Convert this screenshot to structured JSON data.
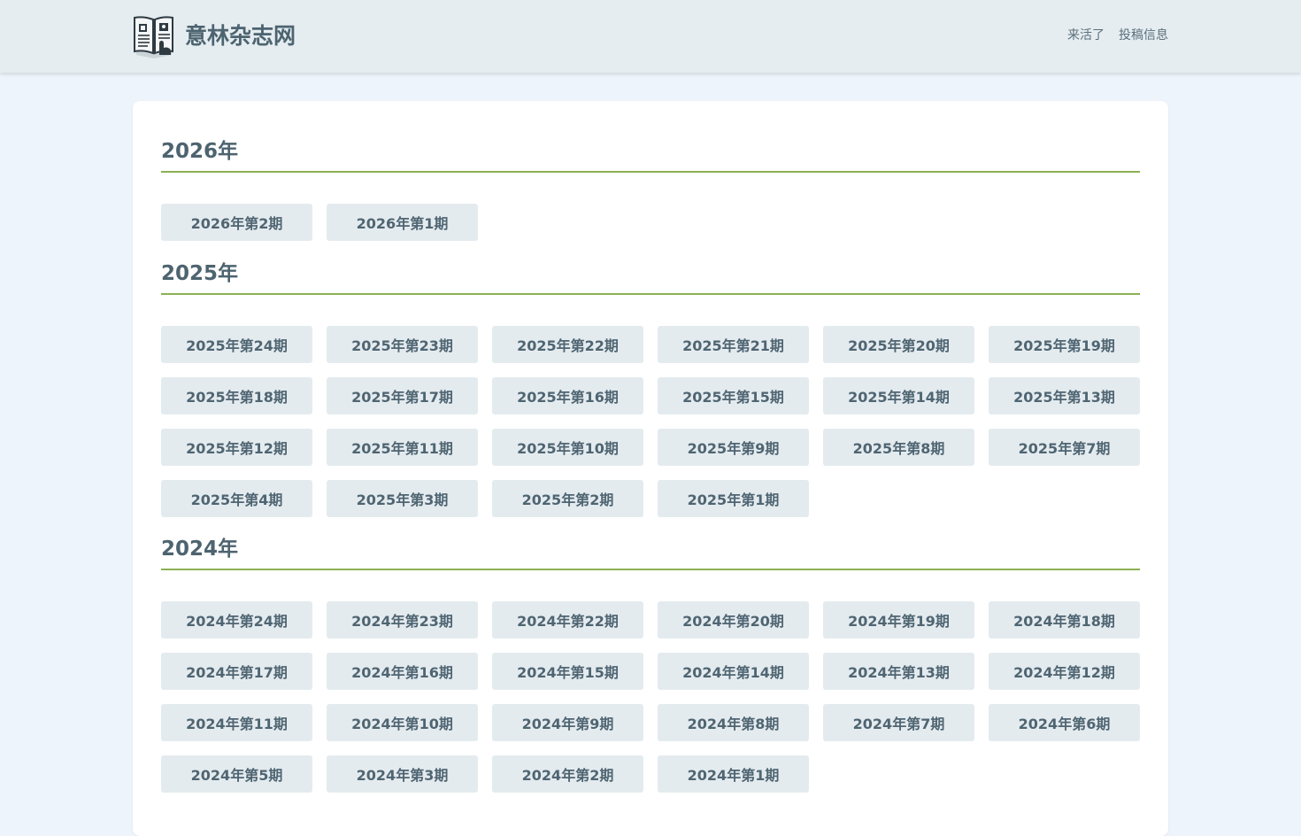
{
  "header": {
    "site_title": "意林杂志网",
    "logo_icon": "magazine-book-icon",
    "nav": [
      "来活了",
      "投稿信息"
    ]
  },
  "years": [
    {
      "label": "2026年",
      "issues": [
        "2026年第2期",
        "2026年第1期"
      ]
    },
    {
      "label": "2025年",
      "issues": [
        "2025年第24期",
        "2025年第23期",
        "2025年第22期",
        "2025年第21期",
        "2025年第20期",
        "2025年第19期",
        "2025年第18期",
        "2025年第17期",
        "2025年第16期",
        "2025年第15期",
        "2025年第14期",
        "2025年第13期",
        "2025年第12期",
        "2025年第11期",
        "2025年第10期",
        "2025年第9期",
        "2025年第8期",
        "2025年第7期",
        "2025年第4期",
        "2025年第3期",
        "2025年第2期",
        "2025年第1期"
      ]
    },
    {
      "label": "2024年",
      "issues": [
        "2024年第24期",
        "2024年第23期",
        "2024年第22期",
        "2024年第20期",
        "2024年第19期",
        "2024年第18期",
        "2024年第17期",
        "2024年第16期",
        "2024年第15期",
        "2024年第14期",
        "2024年第13期",
        "2024年第12期",
        "2024年第11期",
        "2024年第10期",
        "2024年第9期",
        "2024年第8期",
        "2024年第7期",
        "2024年第6期",
        "2024年第5期",
        "2024年第3期",
        "2024年第2期",
        "2024年第1期"
      ]
    }
  ],
  "colors": {
    "accent_line": "#8bb053",
    "button_bg": "#e4ebef",
    "header_bg": "#e5edf1",
    "page_bg": "#eef4fb"
  }
}
